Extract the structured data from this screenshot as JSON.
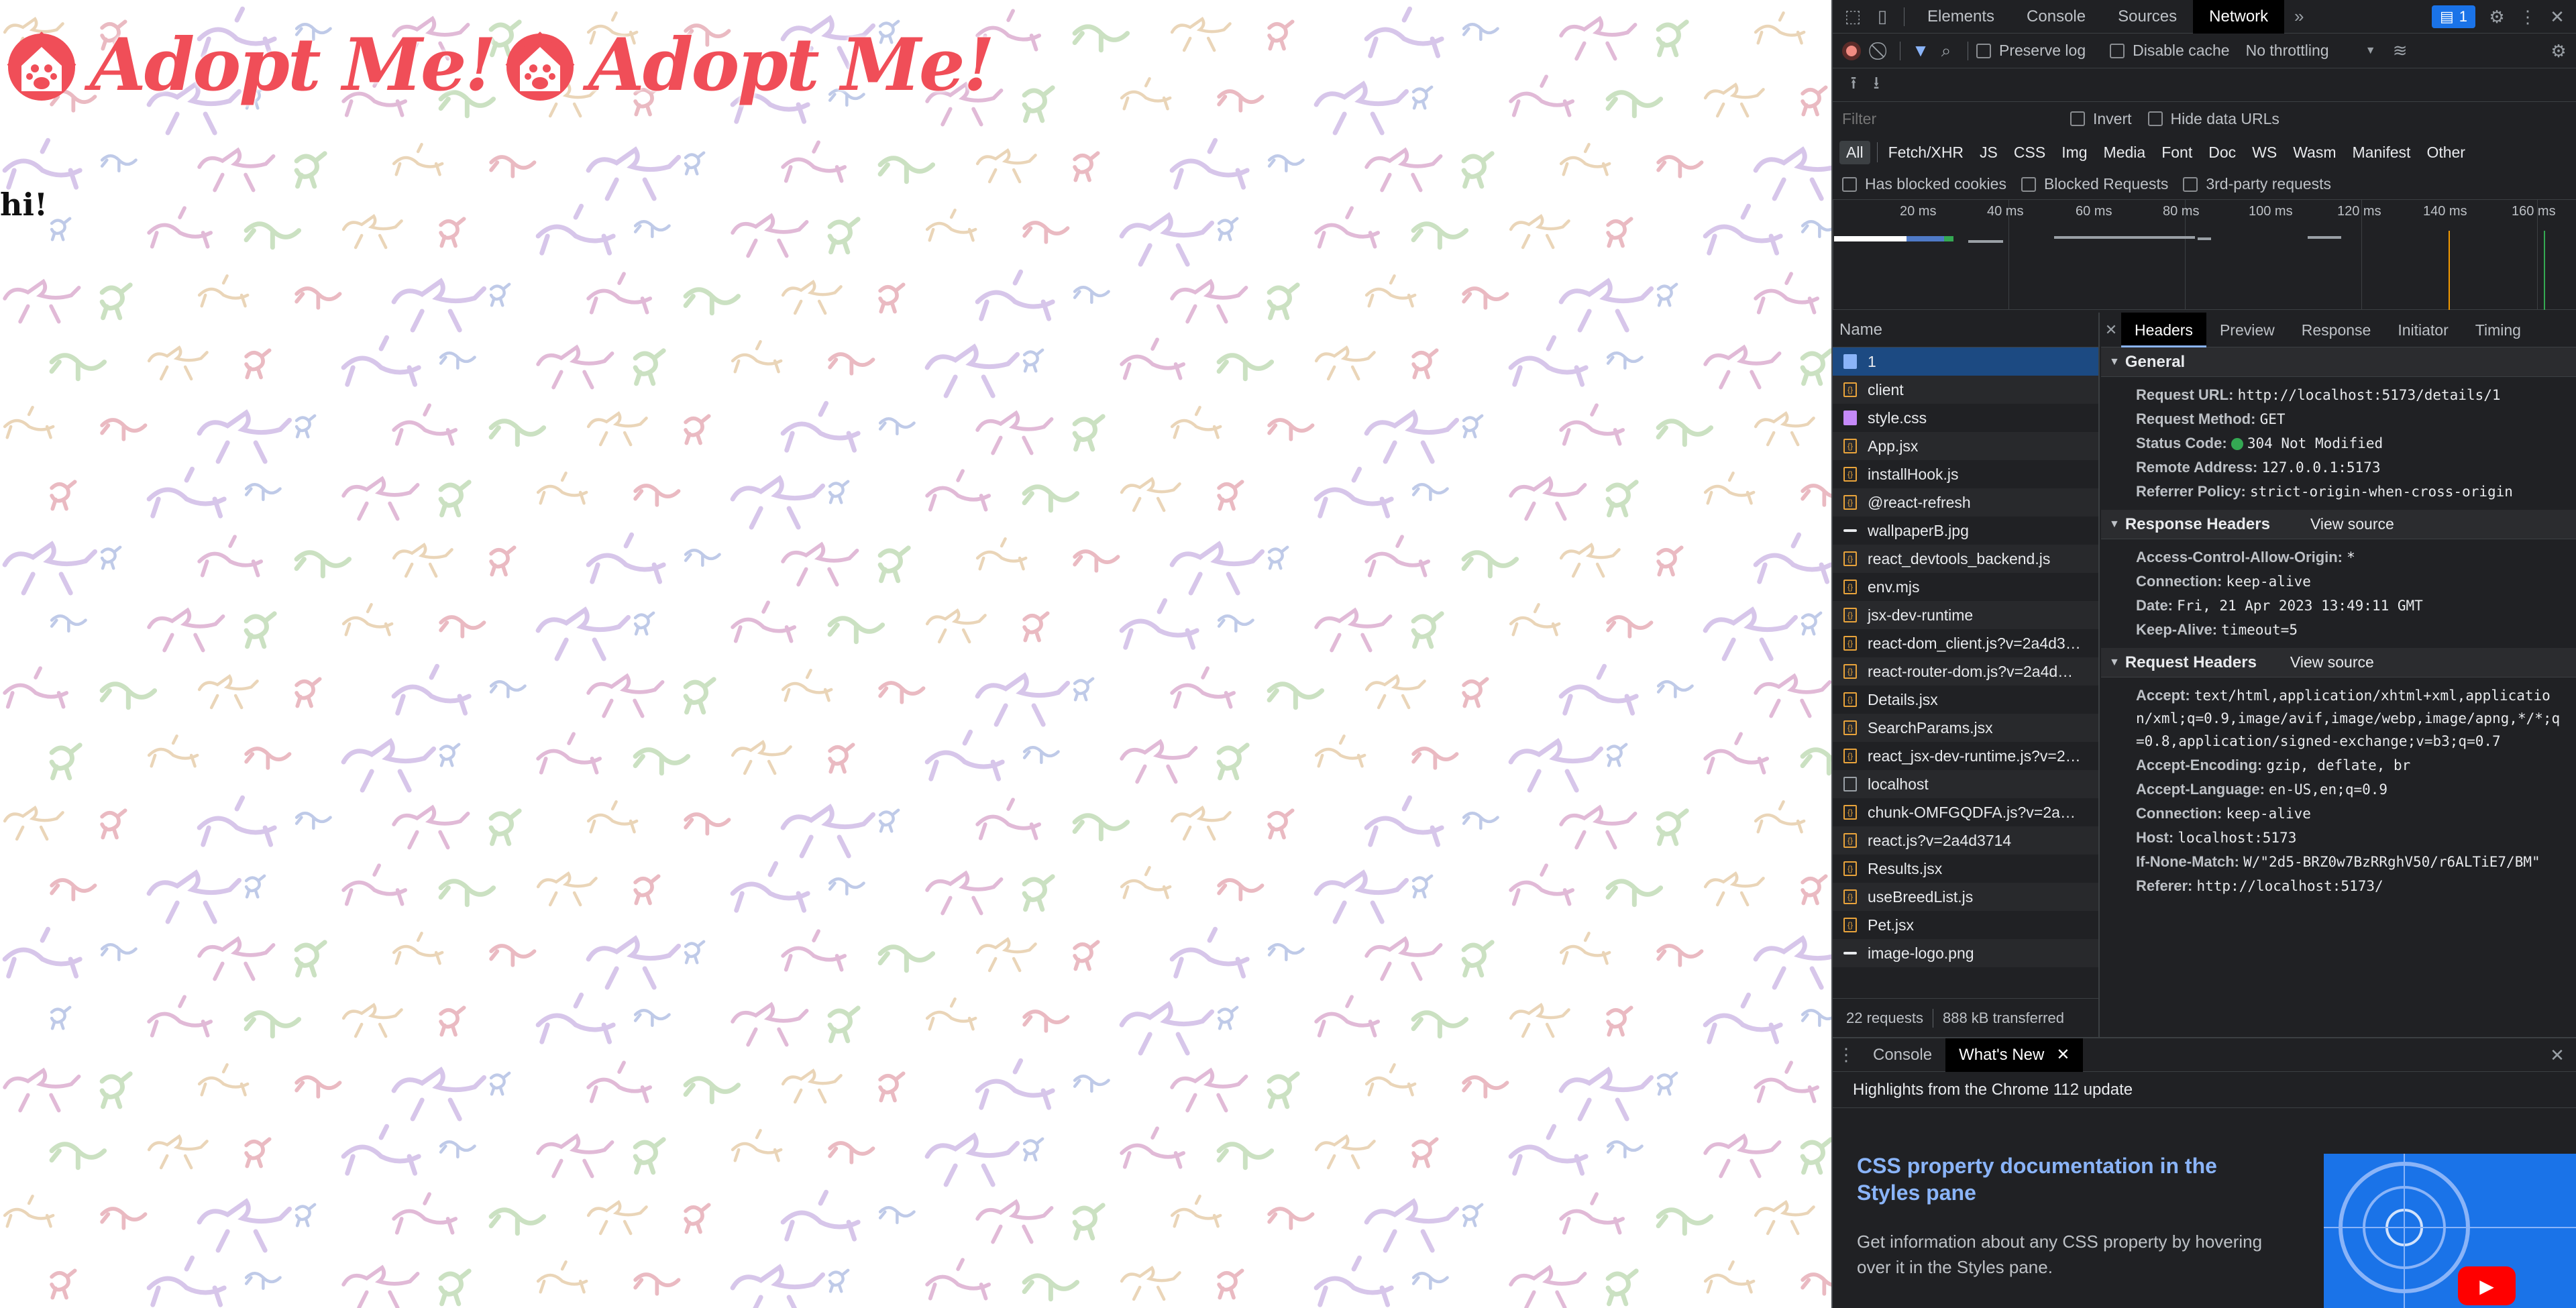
{
  "page": {
    "logo_text": "Adopt Me!",
    "heading": "hi!"
  },
  "devtools": {
    "tabs": [
      "Elements",
      "Console",
      "Sources",
      "Network"
    ],
    "selected_tab": "Network",
    "issues_count": "1",
    "toolbar": {
      "preserve_log": "Preserve log",
      "disable_cache": "Disable cache",
      "throttling": "No throttling"
    },
    "filter": {
      "placeholder": "Filter",
      "invert": "Invert",
      "hide_data_urls": "Hide data URLs"
    },
    "types": [
      "All",
      "Fetch/XHR",
      "JS",
      "CSS",
      "Img",
      "Media",
      "Font",
      "Doc",
      "WS",
      "Wasm",
      "Manifest",
      "Other"
    ],
    "blocked": {
      "has_blocked_cookies": "Has blocked cookies",
      "blocked_requests": "Blocked Requests",
      "third_party": "3rd-party requests"
    },
    "timeline_ticks": [
      "20 ms",
      "40 ms",
      "60 ms",
      "80 ms",
      "100 ms",
      "120 ms",
      "140 ms",
      "160 ms"
    ],
    "name_header": "Name",
    "requests": [
      {
        "name": "1",
        "type": "doc"
      },
      {
        "name": "client",
        "type": "js"
      },
      {
        "name": "style.css",
        "type": "css"
      },
      {
        "name": "App.jsx",
        "type": "js"
      },
      {
        "name": "installHook.js",
        "type": "js"
      },
      {
        "name": "@react-refresh",
        "type": "js"
      },
      {
        "name": "wallpaperB.jpg",
        "type": "img"
      },
      {
        "name": "react_devtools_backend.js",
        "type": "js"
      },
      {
        "name": "env.mjs",
        "type": "js"
      },
      {
        "name": "jsx-dev-runtime",
        "type": "js"
      },
      {
        "name": "react-dom_client.js?v=2a4d3…",
        "type": "js"
      },
      {
        "name": "react-router-dom.js?v=2a4d…",
        "type": "js"
      },
      {
        "name": "Details.jsx",
        "type": "js"
      },
      {
        "name": "SearchParams.jsx",
        "type": "js"
      },
      {
        "name": "react_jsx-dev-runtime.js?v=2…",
        "type": "js"
      },
      {
        "name": "localhost",
        "type": "blank"
      },
      {
        "name": "chunk-OMFGQDFA.js?v=2a…",
        "type": "js"
      },
      {
        "name": "react.js?v=2a4d3714",
        "type": "js"
      },
      {
        "name": "Results.jsx",
        "type": "js"
      },
      {
        "name": "useBreedList.js",
        "type": "js"
      },
      {
        "name": "Pet.jsx",
        "type": "js"
      },
      {
        "name": "image-logo.png",
        "type": "img"
      }
    ],
    "footer": {
      "requests": "22 requests",
      "transferred": "888 kB transferred"
    },
    "detail_tabs": [
      "Headers",
      "Preview",
      "Response",
      "Initiator",
      "Timing"
    ],
    "general": {
      "title": "General",
      "rows": [
        {
          "k": "Request URL:",
          "v": "http://localhost:5173/details/1"
        },
        {
          "k": "Request Method:",
          "v": "GET"
        },
        {
          "k": "Status Code:",
          "v": "304 Not Modified"
        },
        {
          "k": "Remote Address:",
          "v": "127.0.0.1:5173"
        },
        {
          "k": "Referrer Policy:",
          "v": "strict-origin-when-cross-origin"
        }
      ]
    },
    "response_headers": {
      "title": "Response Headers",
      "view_source": "View source",
      "rows": [
        {
          "k": "Access-Control-Allow-Origin:",
          "v": "*"
        },
        {
          "k": "Connection:",
          "v": "keep-alive"
        },
        {
          "k": "Date:",
          "v": "Fri, 21 Apr 2023 13:49:11 GMT"
        },
        {
          "k": "Keep-Alive:",
          "v": "timeout=5"
        }
      ]
    },
    "request_headers": {
      "title": "Request Headers",
      "view_source": "View source",
      "rows": [
        {
          "k": "Accept:",
          "v": "text/html,application/xhtml+xml,application/xml;q=0.9,image/avif,image/webp,image/apng,*/*;q=0.8,application/signed-exchange;v=b3;q=0.7"
        },
        {
          "k": "Accept-Encoding:",
          "v": "gzip, deflate, br"
        },
        {
          "k": "Accept-Language:",
          "v": "en-US,en;q=0.9"
        },
        {
          "k": "Connection:",
          "v": "keep-alive"
        },
        {
          "k": "Host:",
          "v": "localhost:5173"
        },
        {
          "k": "If-None-Match:",
          "v": "W/\"2d5-BRZ0w7BzRRghV50/r6ALTiE7/BM\""
        },
        {
          "k": "Referer:",
          "v": "http://localhost:5173/"
        }
      ]
    },
    "drawer": {
      "tabs": [
        "Console",
        "What's New"
      ],
      "selected_tab": "What's New",
      "highlights": "Highlights from the Chrome 112 update",
      "feature_title": "CSS property documentation in the Styles pane",
      "feature_desc": "Get information about any CSS property by hovering over it in the Styles pane."
    }
  }
}
